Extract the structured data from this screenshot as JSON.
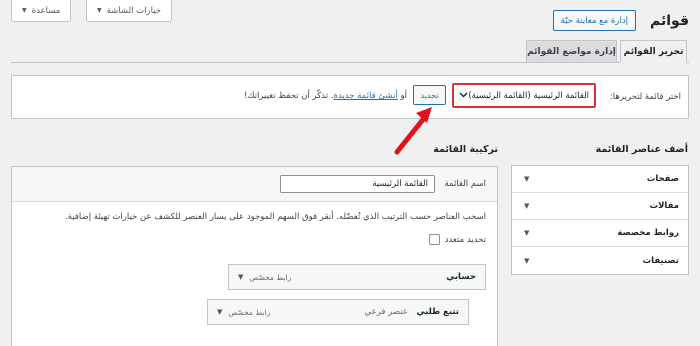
{
  "screen_options": {
    "label": "خيارات الشاشة",
    "icon": "triangle-down-icon"
  },
  "help": {
    "label": "مساعدة",
    "icon": "triangle-down-icon"
  },
  "page_title": "قوائم",
  "manage_live_button": "إدارة مع معاينة حيّة",
  "tabs": [
    {
      "label": "تحرير القوائم",
      "active": true
    },
    {
      "label": "إدارة مواضع القوائم",
      "active": false
    }
  ],
  "select_menu": {
    "label": "اختر قائمة لتحريرها:",
    "selected": "القائمة الرئيسية (القائمة الرئيسية)",
    "button": "تحديد",
    "help_prefix": "أو",
    "create_link": "أنشئ قائمة جديدة",
    "help_suffix": ". تذكّر أن تحفظ تغييراتك!"
  },
  "add_items": {
    "title": "أضف عناصر القائمة",
    "sections": [
      "صفحات",
      "مقالات",
      "روابط مخصصة",
      "تصنيفات"
    ]
  },
  "structure": {
    "title": "تركيبة القائمة",
    "name_label": "اسم القائمة",
    "name_value": "القائمة الرئيسية",
    "instructions": "اسحب العناصر حسب الترتيب الذي تُفضّله. أنقر فوق السهم الموجود على يسار العنصر للكشف عن خيارات تهيئة إضافية.",
    "bulk_select": "تحديد متعدد",
    "items": [
      {
        "title": "حسابي",
        "type": "رابط مخصّص",
        "subtitle": ""
      },
      {
        "title": "تتبع طلبي",
        "type": "رابط مخصّص",
        "subtitle": "عنصر فرعي"
      }
    ]
  },
  "colors": {
    "accent": "#2271b1",
    "highlight": "#d63638",
    "background": "#f0f0f1"
  }
}
